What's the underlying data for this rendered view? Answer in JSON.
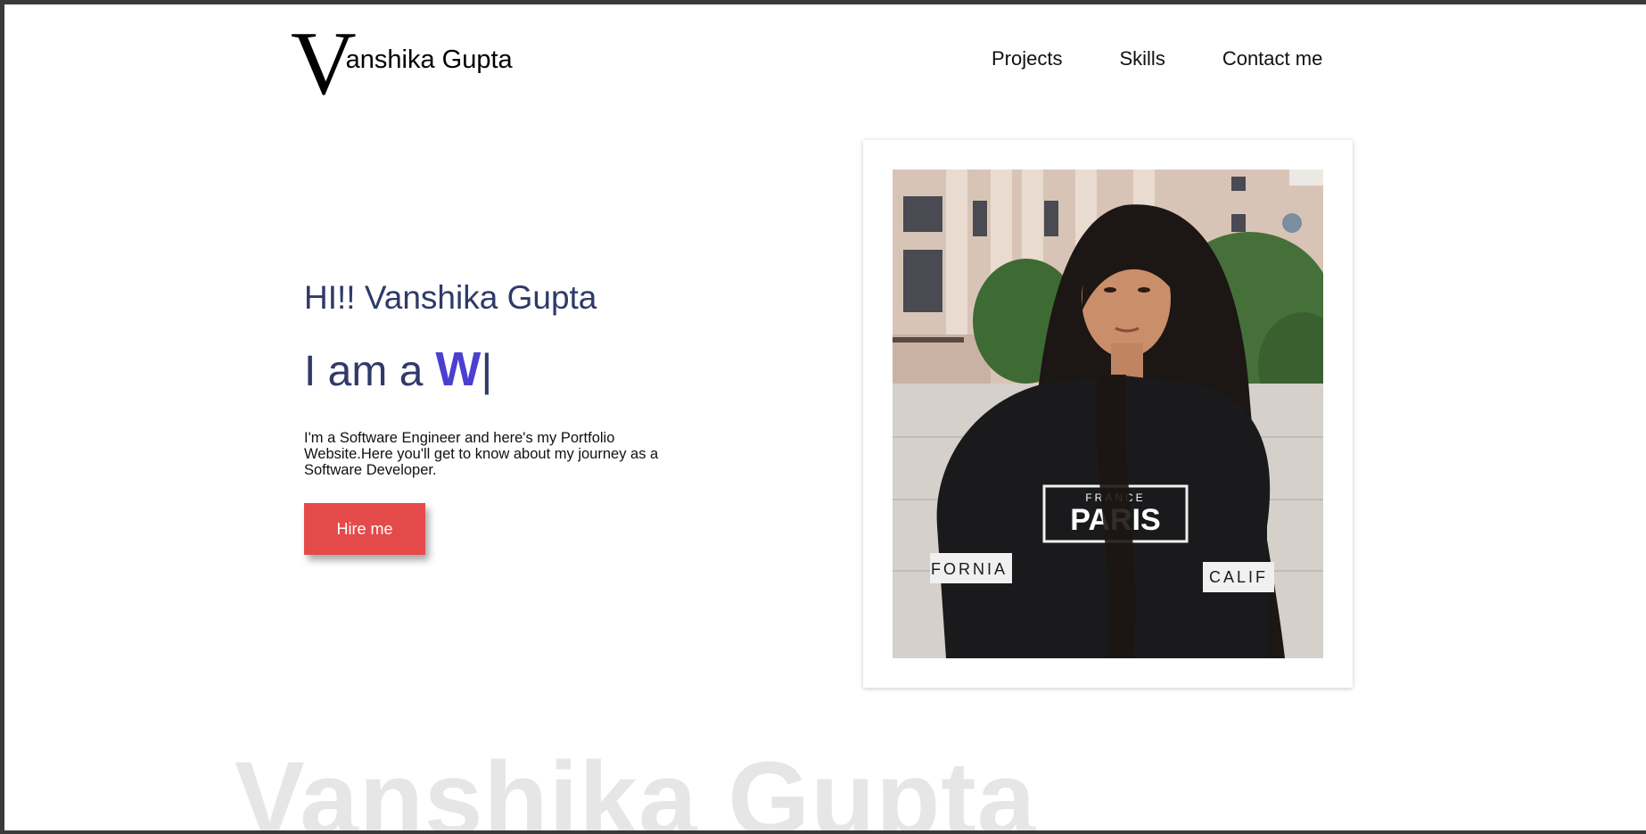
{
  "header": {
    "logo_initial": "V",
    "logo_rest": "anshika Gupta",
    "nav": [
      {
        "label": "Projects"
      },
      {
        "label": "Skills"
      },
      {
        "label": "Contact me"
      }
    ]
  },
  "hero": {
    "greeting": "HI!! Vanshika Gupta",
    "role_prefix": "I am a",
    "role_typed": "W",
    "cursor": "|",
    "bio": "I'm a Software Engineer and here's my Portfolio Website.Here you'll get to know about my journey as a Software Developer.",
    "hire_label": "Hire me"
  },
  "photo": {
    "shirt_text_1": "FRANCE",
    "shirt_text_2": "PARIS",
    "sleeve_left": "FORNIA",
    "sleeve_right": "CALIF"
  },
  "watermark": "Vanshika Gupta",
  "colors": {
    "accent_button": "#e44a49",
    "heading_text": "#2f3a6a",
    "typed_word": "#4b3fd1"
  }
}
